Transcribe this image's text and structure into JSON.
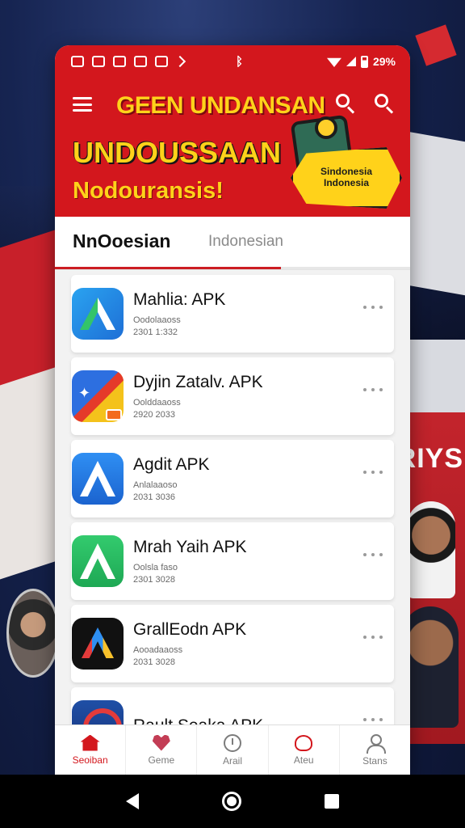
{
  "status_bar": {
    "icons": [
      "photo-icon",
      "screenshot-icon",
      "youtube-icon",
      "shield-icon",
      "camera-icon",
      "arrow-icon",
      "bluetooth-icon",
      "wifi-icon",
      "signal-icon",
      "battery-icon"
    ],
    "battery_text": "29%"
  },
  "header": {
    "title": "GEEN UNDANSAN",
    "headline": "UNDOUSSAAN",
    "subline": "Nodouransis!",
    "promo_text": "Sindonesia Indonesia"
  },
  "tabs": [
    {
      "label": "NnOoesian",
      "active": true
    },
    {
      "label": "Indonesian",
      "active": false
    }
  ],
  "apps": [
    {
      "name": "Mahlia: APK",
      "category": "Oodolaaoss",
      "date": "2301 1:332",
      "icon": "a-blue-green-icon"
    },
    {
      "name": "Dyjin Zatalv. APK",
      "category": "Oolddaaoss",
      "date": "2920 2033",
      "icon": "pinwheel-icon"
    },
    {
      "name": "Agdit APK",
      "category": "Anlalaaoso",
      "date": "2031 3036",
      "icon": "a-blue-icon"
    },
    {
      "name": "Mrah Yaih APK",
      "category": "Oolsla faso",
      "date": "2301 3028",
      "icon": "a-green-icon"
    },
    {
      "name": "GrallEodn APK",
      "category": "Aooadaaoss",
      "date": "2031 3028",
      "icon": "a-multicolor-icon"
    },
    {
      "name": "Rault Seaka APK",
      "category": "",
      "date": "",
      "icon": "red-ring-icon"
    }
  ],
  "bottom_nav": [
    {
      "label": "Seoiban",
      "icon": "home-icon",
      "active": true
    },
    {
      "label": "Geme",
      "icon": "heart-icon",
      "active": false
    },
    {
      "label": "Arail",
      "icon": "clock-icon",
      "active": false
    },
    {
      "label": "Ateu",
      "icon": "heart-outline-icon",
      "active": false
    },
    {
      "label": "Stans",
      "icon": "user-icon",
      "active": false
    }
  ],
  "background": {
    "banner_text": "RIYS"
  },
  "colors": {
    "brand_red": "#d3171d",
    "headline_yellow": "#ffd21a"
  }
}
